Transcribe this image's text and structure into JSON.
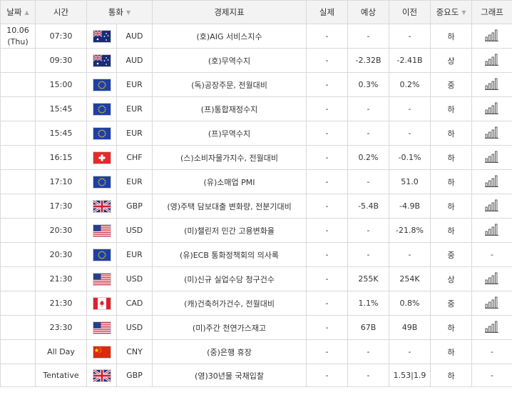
{
  "headers": {
    "date": "날짜",
    "time": "시간",
    "currency": "통화",
    "indicator": "경제지표",
    "actual": "실제",
    "forecast": "예상",
    "previous": "이전",
    "importance": "중요도",
    "graph": "그래프"
  },
  "date": {
    "day": "10.06",
    "weekday": "(Thu)"
  },
  "rows": [
    {
      "time": "07:30",
      "flag": "australia-flag",
      "currency": "AUD",
      "event": "(호)AIG 서비스지수",
      "actual": "-",
      "forecast": "-",
      "previous": "-",
      "importance": "하",
      "graph": true
    },
    {
      "time": "09:30",
      "flag": "australia-flag",
      "currency": "AUD",
      "event": "(호)무역수지",
      "actual": "-",
      "forecast": "-2.32B",
      "previous": "-2.41B",
      "importance": "상",
      "graph": true
    },
    {
      "time": "15:00",
      "flag": "eu-flag",
      "currency": "EUR",
      "event": "(독)공장주문, 전월대비",
      "actual": "-",
      "forecast": "0.3%",
      "previous": "0.2%",
      "importance": "중",
      "graph": true
    },
    {
      "time": "15:45",
      "flag": "eu-flag",
      "currency": "EUR",
      "event": "(프)통합재정수지",
      "actual": "-",
      "forecast": "-",
      "previous": "-",
      "importance": "하",
      "graph": true
    },
    {
      "time": "15:45",
      "flag": "eu-flag",
      "currency": "EUR",
      "event": "(프)무역수지",
      "actual": "-",
      "forecast": "-",
      "previous": "-",
      "importance": "하",
      "graph": true
    },
    {
      "time": "16:15",
      "flag": "switzerland-flag",
      "currency": "CHF",
      "event": "(스)소비자물가지수, 전월대비",
      "actual": "-",
      "forecast": "0.2%",
      "previous": "-0.1%",
      "importance": "하",
      "graph": true
    },
    {
      "time": "17:10",
      "flag": "eu-flag",
      "currency": "EUR",
      "event": "(유)소매업 PMI",
      "actual": "-",
      "forecast": "-",
      "previous": "51.0",
      "importance": "하",
      "graph": true
    },
    {
      "time": "17:30",
      "flag": "uk-flag",
      "currency": "GBP",
      "event": "(영)주택 담보대출 변화량, 전분기대비",
      "actual": "-",
      "forecast": "-5.4B",
      "previous": "-4.9B",
      "importance": "하",
      "graph": true
    },
    {
      "time": "20:30",
      "flag": "usa-flag",
      "currency": "USD",
      "event": "(미)챌린저 민간 고용변화율",
      "actual": "-",
      "forecast": "-",
      "previous": "-21.8%",
      "importance": "하",
      "graph": true
    },
    {
      "time": "20:30",
      "flag": "eu-flag",
      "currency": "EUR",
      "event": "(유)ECB 통화정책회의 의사록",
      "actual": "-",
      "forecast": "-",
      "previous": "-",
      "importance": "중",
      "graph": false
    },
    {
      "time": "21:30",
      "flag": "usa-flag",
      "currency": "USD",
      "event": "(미)신규 실업수당 청구건수",
      "actual": "-",
      "forecast": "255K",
      "previous": "254K",
      "importance": "상",
      "graph": true
    },
    {
      "time": "21:30",
      "flag": "canada-flag",
      "currency": "CAD",
      "event": "(캐)건축허가건수, 전월대비",
      "actual": "-",
      "forecast": "1.1%",
      "previous": "0.8%",
      "importance": "중",
      "graph": true
    },
    {
      "time": "23:30",
      "flag": "usa-flag",
      "currency": "USD",
      "event": "(미)주간 천연가스재고",
      "actual": "-",
      "forecast": "67B",
      "previous": "49B",
      "importance": "하",
      "graph": true
    },
    {
      "time": "All Day",
      "flag": "china-flag",
      "currency": "CNY",
      "event": "(중)은행 휴장",
      "actual": "-",
      "forecast": "-",
      "previous": "-",
      "importance": "하",
      "graph": false
    },
    {
      "time": "Tentative",
      "flag": "uk-flag",
      "currency": "GBP",
      "event": "(영)30년물 국채입찰",
      "actual": "-",
      "forecast": "-",
      "previous": "1.53|1.9",
      "importance": "하",
      "graph": false
    }
  ],
  "no_graph_text": "-",
  "colors": {
    "header_bg": "#f3f3f3",
    "border": "#d9d9d9",
    "icon": "#555555"
  }
}
